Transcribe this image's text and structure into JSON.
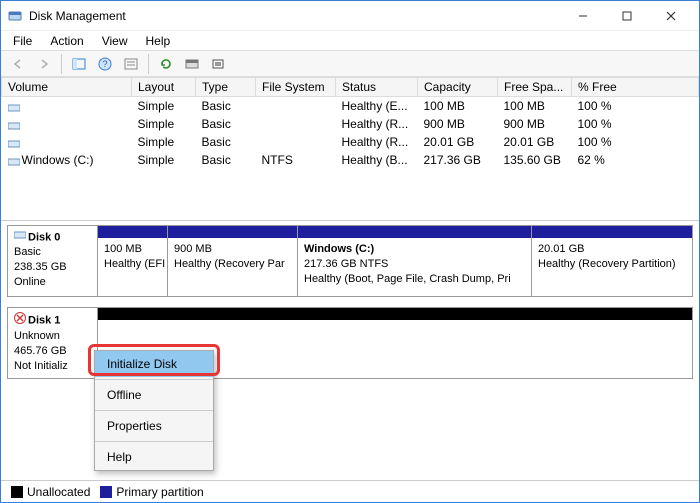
{
  "window": {
    "title": "Disk Management"
  },
  "menu": {
    "file": "File",
    "action": "Action",
    "view": "View",
    "help": "Help"
  },
  "columns": {
    "volume": "Volume",
    "layout": "Layout",
    "type": "Type",
    "filesystem": "File System",
    "status": "Status",
    "capacity": "Capacity",
    "freespace": "Free Spa...",
    "pctfree": "% Free"
  },
  "volumes": [
    {
      "name": "",
      "layout": "Simple",
      "type": "Basic",
      "fs": "",
      "status": "Healthy (E...",
      "capacity": "100 MB",
      "free": "100 MB",
      "pct": "100 %"
    },
    {
      "name": "",
      "layout": "Simple",
      "type": "Basic",
      "fs": "",
      "status": "Healthy (R...",
      "capacity": "900 MB",
      "free": "900 MB",
      "pct": "100 %"
    },
    {
      "name": "",
      "layout": "Simple",
      "type": "Basic",
      "fs": "",
      "status": "Healthy (R...",
      "capacity": "20.01 GB",
      "free": "20.01 GB",
      "pct": "100 %"
    },
    {
      "name": "Windows (C:)",
      "layout": "Simple",
      "type": "Basic",
      "fs": "NTFS",
      "status": "Healthy (B...",
      "capacity": "217.36 GB",
      "free": "135.60 GB",
      "pct": "62 %"
    }
  ],
  "disk0": {
    "title": "Disk 0",
    "type": "Basic",
    "size": "238.35 GB",
    "state": "Online",
    "parts": [
      {
        "title": "",
        "size": "100 MB",
        "status": "Healthy (EFI S"
      },
      {
        "title": "",
        "size": "900 MB",
        "status": "Healthy (Recovery Par"
      },
      {
        "title": "Windows  (C:)",
        "size": "217.36 GB NTFS",
        "status": "Healthy (Boot, Page File, Crash Dump, Pri"
      },
      {
        "title": "",
        "size": "20.01 GB",
        "status": "Healthy (Recovery Partition)"
      }
    ]
  },
  "disk1": {
    "title": "Disk 1",
    "type": "Unknown",
    "size": "465.76 GB",
    "state": "Not Initializ"
  },
  "contextMenu": {
    "initialize": "Initialize Disk",
    "offline": "Offline",
    "properties": "Properties",
    "help": "Help"
  },
  "legend": {
    "unallocated": "Unallocated",
    "primary": "Primary partition"
  }
}
